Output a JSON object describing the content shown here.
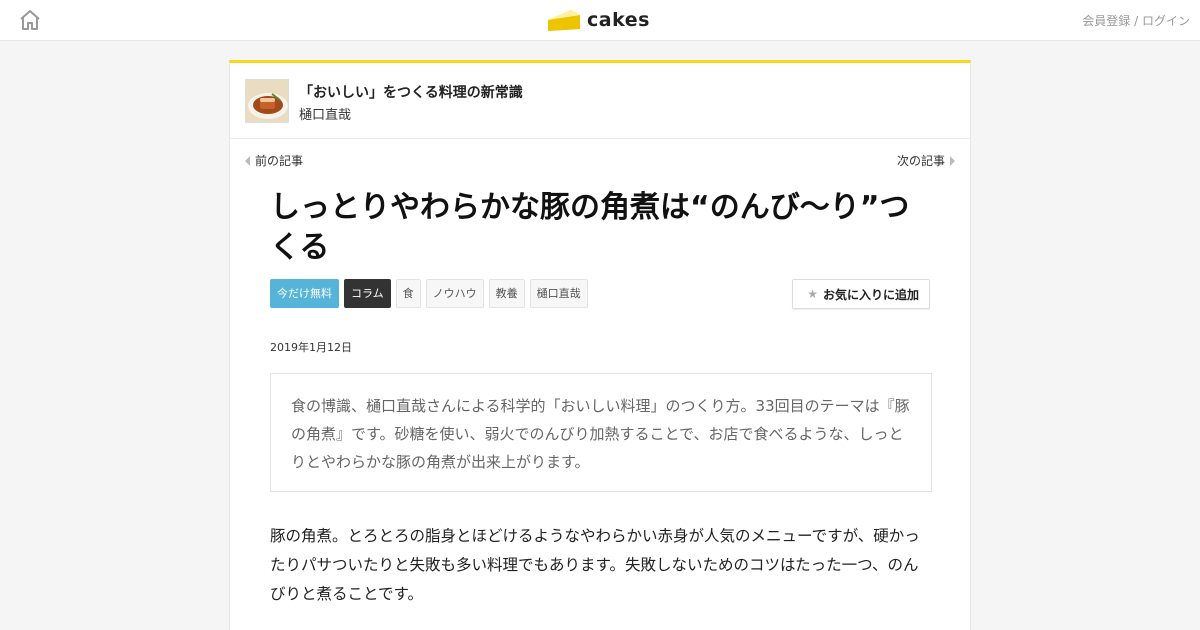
{
  "header": {
    "logo_text": "cakes",
    "auth": {
      "register": "会員登録",
      "separator": "/",
      "login": "ログイン"
    }
  },
  "series": {
    "title": "「おいしい」をつくる料理の新常識",
    "author": "樋口直哉"
  },
  "nav": {
    "prev": "前の記事",
    "next": "次の記事"
  },
  "article": {
    "title": "しっとりやわらかな豚の角煮は“のんび〜り”つくる",
    "tags": [
      "今だけ無料",
      "コラム",
      "食",
      "ノウハウ",
      "教養",
      "樋口直哉"
    ],
    "favorite_label": "お気に入りに追加",
    "date": "2019年1月12日",
    "lead": "食の博識、樋口直哉さんによる科学的「おいしい料理」のつくり方。33回目のテーマは『豚の角煮』です。砂糖を使い、弱火でのんびり加熱することで、お店で食べるような、しっとりとやわらかな豚の角煮が出来上がります。",
    "body": "豚の角煮。とろとろの脂身とほどけるようなやわらかい赤身が人気のメニューですが、硬かったりパサついたりと失敗も多い料理でもあります。失敗しないためのコツはたった一つ、のんびりと煮ることです。"
  },
  "colors": {
    "brand_yellow": "#f6d91c",
    "free_tag": "#57b4d9",
    "column_tag": "#333333"
  },
  "icons": [
    "home-icon",
    "cake-logo-icon",
    "star-icon",
    "chevron-left-icon",
    "chevron-right-icon"
  ]
}
